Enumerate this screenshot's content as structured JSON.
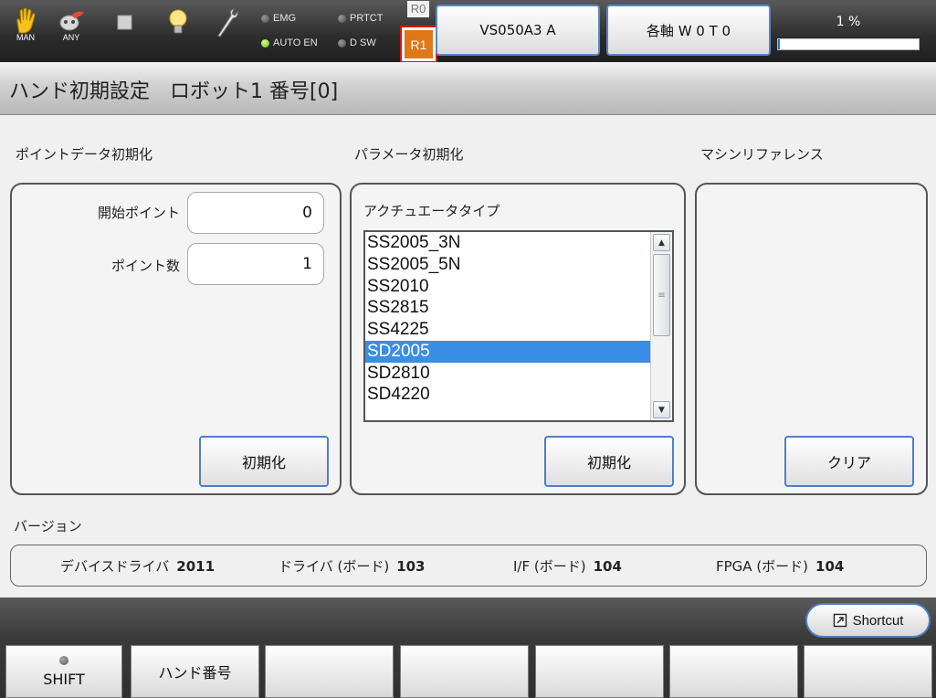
{
  "top": {
    "icons": [
      {
        "name": "hand-icon",
        "caption": "MAN"
      },
      {
        "name": "robot-face-icon",
        "caption": "ANY"
      },
      {
        "name": "stop-square-icon",
        "caption": ""
      },
      {
        "name": "lightbulb-icon",
        "caption": ""
      },
      {
        "name": "wrench-icon",
        "caption": ""
      }
    ],
    "lamps": [
      {
        "label": "EMG",
        "on": false
      },
      {
        "label": "PRTCT",
        "on": false
      },
      {
        "label": "AUTO EN",
        "on": true
      },
      {
        "label": "D SW",
        "on": false
      }
    ],
    "r0_label": "R0",
    "r1_label": "R1",
    "robot_button": "VS050A3 A",
    "axis_button": "各軸  W 0 T 0",
    "speed_text": "1 %",
    "speed_value": 0.01
  },
  "title": "ハンド初期設定　ロボット1 番号[0]",
  "point_init": {
    "label": "ポイントデータ初期化",
    "start_label": "開始ポイント",
    "start_value": "0",
    "count_label": "ポイント数",
    "count_value": "1",
    "button": "初期化"
  },
  "param_init": {
    "label": "パラメータ初期化",
    "actuator_label": "アクチュエータタイプ",
    "items": [
      "SS2005_3N",
      "SS2005_5N",
      "SS2010",
      "SS2815",
      "SS4225",
      "SD2005",
      "SD2810",
      "SD4220"
    ],
    "selected": "SD2005",
    "button": "初期化"
  },
  "machine_ref": {
    "label": "マシンリファレンス",
    "button": "クリア"
  },
  "version": {
    "label": "バージョン",
    "items": [
      {
        "name": "デバイスドライバ",
        "value": "2011"
      },
      {
        "name": "ドライバ (ボード)",
        "value": "103"
      },
      {
        "name": "I/F (ボード)",
        "value": "104"
      },
      {
        "name": "FPGA (ボード)",
        "value": "104"
      }
    ]
  },
  "shortcut_label": "Shortcut",
  "fkeys": [
    "SHIFT",
    "ハンド番号",
    "",
    "",
    "",
    "",
    ""
  ],
  "colors": {
    "selection": "#3a8ee6",
    "button_border": "#4f7fc6",
    "alarm_red": "#e01010",
    "r1_orange": "#e07818",
    "lamp_green": "#53c21b"
  }
}
